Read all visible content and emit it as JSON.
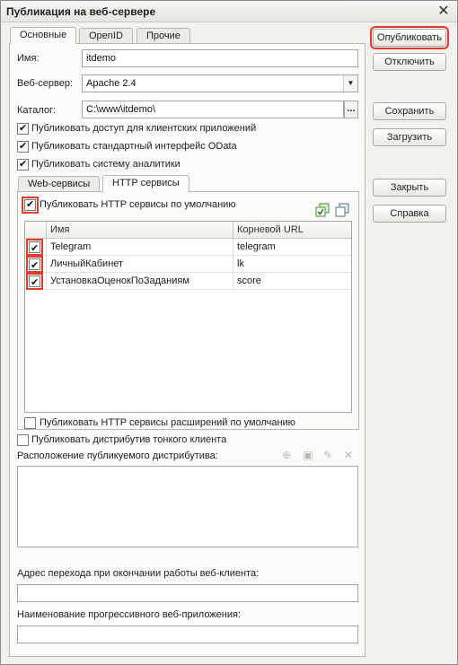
{
  "window": {
    "title": "Публикация на веб-сервере",
    "close_glyph": "✕"
  },
  "buttons": {
    "publish": "Опубликовать",
    "disable": "Отключить",
    "save": "Сохранить",
    "load": "Загрузить",
    "close": "Закрыть",
    "help": "Справка"
  },
  "tabs": [
    "Основные",
    "OpenID",
    "Прочие"
  ],
  "form": {
    "name_label": "Имя:",
    "name_value": "itdemo",
    "server_label": "Веб-сервер:",
    "server_value": "Apache 2.4",
    "catalog_label": "Каталог:",
    "catalog_value": "C:\\www\\itdemo\\",
    "dots": "...",
    "dropdown_glyph": "▼"
  },
  "checks": {
    "client_apps": {
      "label": "Публиковать доступ для клиентских приложений",
      "checked": true
    },
    "odata": {
      "label": "Публиковать стандартный интерфейс OData",
      "checked": true
    },
    "analytics": {
      "label": "Публиковать систему аналитики",
      "checked": true
    }
  },
  "inner_tabs": [
    "Web-сервисы",
    "HTTP сервисы"
  ],
  "http": {
    "default_label": "Публиковать HTTP сервисы по умолчанию",
    "default_checked": true,
    "columns": [
      "Имя",
      "Корневой URL"
    ],
    "rows": [
      {
        "checked": true,
        "name": "Telegram",
        "url": "telegram"
      },
      {
        "checked": true,
        "name": "ЛичныйКабинет",
        "url": "lk"
      },
      {
        "checked": true,
        "name": "УстановкаОценокПоЗаданиям",
        "url": "score"
      }
    ],
    "extensions_label": "Публиковать HTTP сервисы расширений по умолчанию",
    "extensions_checked": false
  },
  "thin_client": {
    "label": "Публиковать дистрибутив тонкого клиента",
    "checked": false,
    "location_label": "Расположение публикуемого дистрибутива:"
  },
  "exit_url": {
    "label": "Адрес перехода при окончании работы веб-клиента:",
    "value": ""
  },
  "pwa": {
    "label": "Наименование прогрессивного веб-приложения:",
    "value": ""
  }
}
